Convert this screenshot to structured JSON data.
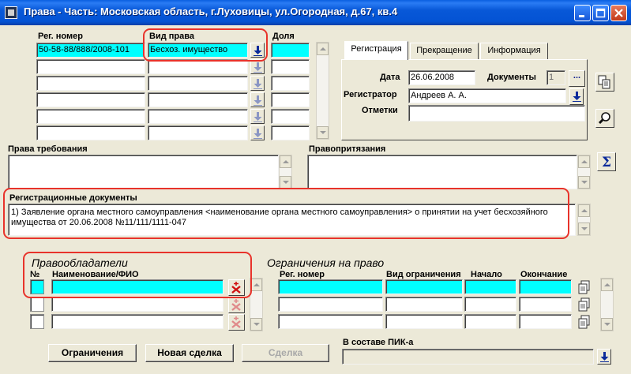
{
  "window": {
    "title": "Права - Часть: Московская область, г.Луховицы, ул.Огородная, д.67, кв.4"
  },
  "colors": {
    "highlight": "#00ffff",
    "annotation": "#e8332b",
    "titlebar": "#0453d4"
  },
  "rights": {
    "reg_number_label": "Рег. номер",
    "right_type_label": "Вид права",
    "share_label": "Доля",
    "reg_number_value": "50-58-88/888/2008-101",
    "right_type_value": "Бесхоз. имущество"
  },
  "tabs": [
    "Регистрация",
    "Прекращение",
    "Информация"
  ],
  "registration": {
    "date_label": "Дата",
    "date_value": "26.06.2008",
    "documents_label": "Документы",
    "documents_count": "1",
    "registrar_label": "Регистратор",
    "registrar_value": "Андреев А. А.",
    "notes_label": "Отметки",
    "more_button": "..."
  },
  "claims": {
    "rights_claims_label": "Права требования",
    "pretensions_label": "Правопритязания"
  },
  "reg_docs": {
    "label": "Регистрационные документы",
    "line1": "1) Заявление органа местного самоуправления <наименование органа местного самоуправления> о принятии на учет бесхозяйного",
    "line2": "имущества от 20.06.2008 №11/111/1111-047"
  },
  "holders": {
    "title": "Правообладатели",
    "num_label": "№",
    "name_label": "Наименование/ФИО"
  },
  "restrictions": {
    "title": "Ограничения на право",
    "reg_number_label": "Рег. номер",
    "type_label": "Вид ограничения",
    "start_label": "Начало",
    "end_label": "Окончание"
  },
  "buttons": {
    "restrictions": "Ограничения",
    "new_deal": "Новая сделка",
    "deal": "Сделка"
  },
  "pik": {
    "label": "В составе ПИК-а"
  },
  "icons": {
    "copy": "copy-icon",
    "search": "magnifier-icon",
    "sum": "sigma-icon",
    "dropdown": "down-arrow-icon",
    "delete": "delete-person-icon",
    "docs": "documents-icon"
  }
}
